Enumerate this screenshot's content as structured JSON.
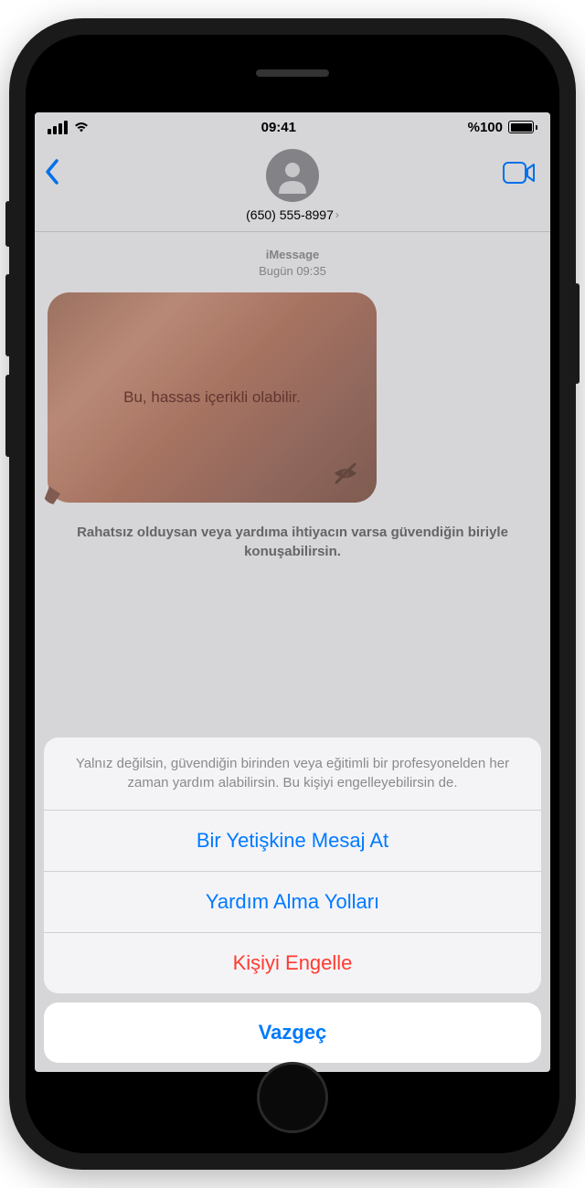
{
  "status": {
    "time": "09:41",
    "battery_text": "%100"
  },
  "header": {
    "contact_number": "(650) 555-8997"
  },
  "chat": {
    "service": "iMessage",
    "timestamp": "Bugün 09:35",
    "sensitive_label": "Bu, hassas içerikli olabilir.",
    "help_prompt": "Rahatsız olduysan veya yardıma ihtiyacın varsa güvendiğin biriyle konuşabilirsin."
  },
  "sheet": {
    "message": "Yalnız değilsin, güvendiğin birinden veya eğitimli bir profesyonelden her zaman yardım alabilirsin. Bu kişiyi engelleyebilirsin de.",
    "option1": "Bir Yetişkine Mesaj At",
    "option2": "Yardım Alma Yolları",
    "option3": "Kişiyi Engelle",
    "cancel": "Vazgeç"
  }
}
